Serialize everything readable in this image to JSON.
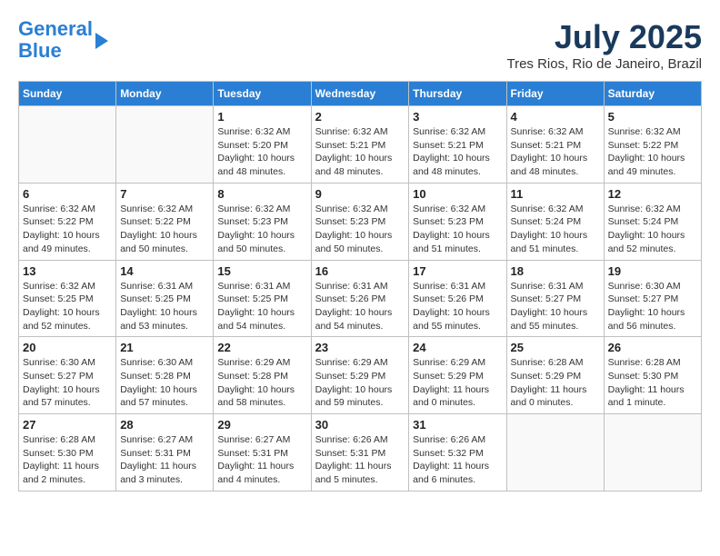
{
  "header": {
    "logo_line1": "General",
    "logo_line2": "Blue",
    "month": "July 2025",
    "location": "Tres Rios, Rio de Janeiro, Brazil"
  },
  "days_of_week": [
    "Sunday",
    "Monday",
    "Tuesday",
    "Wednesday",
    "Thursday",
    "Friday",
    "Saturday"
  ],
  "weeks": [
    [
      {
        "day": "",
        "info": ""
      },
      {
        "day": "",
        "info": ""
      },
      {
        "day": "1",
        "info": "Sunrise: 6:32 AM\nSunset: 5:20 PM\nDaylight: 10 hours\nand 48 minutes."
      },
      {
        "day": "2",
        "info": "Sunrise: 6:32 AM\nSunset: 5:21 PM\nDaylight: 10 hours\nand 48 minutes."
      },
      {
        "day": "3",
        "info": "Sunrise: 6:32 AM\nSunset: 5:21 PM\nDaylight: 10 hours\nand 48 minutes."
      },
      {
        "day": "4",
        "info": "Sunrise: 6:32 AM\nSunset: 5:21 PM\nDaylight: 10 hours\nand 48 minutes."
      },
      {
        "day": "5",
        "info": "Sunrise: 6:32 AM\nSunset: 5:22 PM\nDaylight: 10 hours\nand 49 minutes."
      }
    ],
    [
      {
        "day": "6",
        "info": "Sunrise: 6:32 AM\nSunset: 5:22 PM\nDaylight: 10 hours\nand 49 minutes."
      },
      {
        "day": "7",
        "info": "Sunrise: 6:32 AM\nSunset: 5:22 PM\nDaylight: 10 hours\nand 50 minutes."
      },
      {
        "day": "8",
        "info": "Sunrise: 6:32 AM\nSunset: 5:23 PM\nDaylight: 10 hours\nand 50 minutes."
      },
      {
        "day": "9",
        "info": "Sunrise: 6:32 AM\nSunset: 5:23 PM\nDaylight: 10 hours\nand 50 minutes."
      },
      {
        "day": "10",
        "info": "Sunrise: 6:32 AM\nSunset: 5:23 PM\nDaylight: 10 hours\nand 51 minutes."
      },
      {
        "day": "11",
        "info": "Sunrise: 6:32 AM\nSunset: 5:24 PM\nDaylight: 10 hours\nand 51 minutes."
      },
      {
        "day": "12",
        "info": "Sunrise: 6:32 AM\nSunset: 5:24 PM\nDaylight: 10 hours\nand 52 minutes."
      }
    ],
    [
      {
        "day": "13",
        "info": "Sunrise: 6:32 AM\nSunset: 5:25 PM\nDaylight: 10 hours\nand 52 minutes."
      },
      {
        "day": "14",
        "info": "Sunrise: 6:31 AM\nSunset: 5:25 PM\nDaylight: 10 hours\nand 53 minutes."
      },
      {
        "day": "15",
        "info": "Sunrise: 6:31 AM\nSunset: 5:25 PM\nDaylight: 10 hours\nand 54 minutes."
      },
      {
        "day": "16",
        "info": "Sunrise: 6:31 AM\nSunset: 5:26 PM\nDaylight: 10 hours\nand 54 minutes."
      },
      {
        "day": "17",
        "info": "Sunrise: 6:31 AM\nSunset: 5:26 PM\nDaylight: 10 hours\nand 55 minutes."
      },
      {
        "day": "18",
        "info": "Sunrise: 6:31 AM\nSunset: 5:27 PM\nDaylight: 10 hours\nand 55 minutes."
      },
      {
        "day": "19",
        "info": "Sunrise: 6:30 AM\nSunset: 5:27 PM\nDaylight: 10 hours\nand 56 minutes."
      }
    ],
    [
      {
        "day": "20",
        "info": "Sunrise: 6:30 AM\nSunset: 5:27 PM\nDaylight: 10 hours\nand 57 minutes."
      },
      {
        "day": "21",
        "info": "Sunrise: 6:30 AM\nSunset: 5:28 PM\nDaylight: 10 hours\nand 57 minutes."
      },
      {
        "day": "22",
        "info": "Sunrise: 6:29 AM\nSunset: 5:28 PM\nDaylight: 10 hours\nand 58 minutes."
      },
      {
        "day": "23",
        "info": "Sunrise: 6:29 AM\nSunset: 5:29 PM\nDaylight: 10 hours\nand 59 minutes."
      },
      {
        "day": "24",
        "info": "Sunrise: 6:29 AM\nSunset: 5:29 PM\nDaylight: 11 hours\nand 0 minutes."
      },
      {
        "day": "25",
        "info": "Sunrise: 6:28 AM\nSunset: 5:29 PM\nDaylight: 11 hours\nand 0 minutes."
      },
      {
        "day": "26",
        "info": "Sunrise: 6:28 AM\nSunset: 5:30 PM\nDaylight: 11 hours\nand 1 minute."
      }
    ],
    [
      {
        "day": "27",
        "info": "Sunrise: 6:28 AM\nSunset: 5:30 PM\nDaylight: 11 hours\nand 2 minutes."
      },
      {
        "day": "28",
        "info": "Sunrise: 6:27 AM\nSunset: 5:31 PM\nDaylight: 11 hours\nand 3 minutes."
      },
      {
        "day": "29",
        "info": "Sunrise: 6:27 AM\nSunset: 5:31 PM\nDaylight: 11 hours\nand 4 minutes."
      },
      {
        "day": "30",
        "info": "Sunrise: 6:26 AM\nSunset: 5:31 PM\nDaylight: 11 hours\nand 5 minutes."
      },
      {
        "day": "31",
        "info": "Sunrise: 6:26 AM\nSunset: 5:32 PM\nDaylight: 11 hours\nand 6 minutes."
      },
      {
        "day": "",
        "info": ""
      },
      {
        "day": "",
        "info": ""
      }
    ]
  ]
}
